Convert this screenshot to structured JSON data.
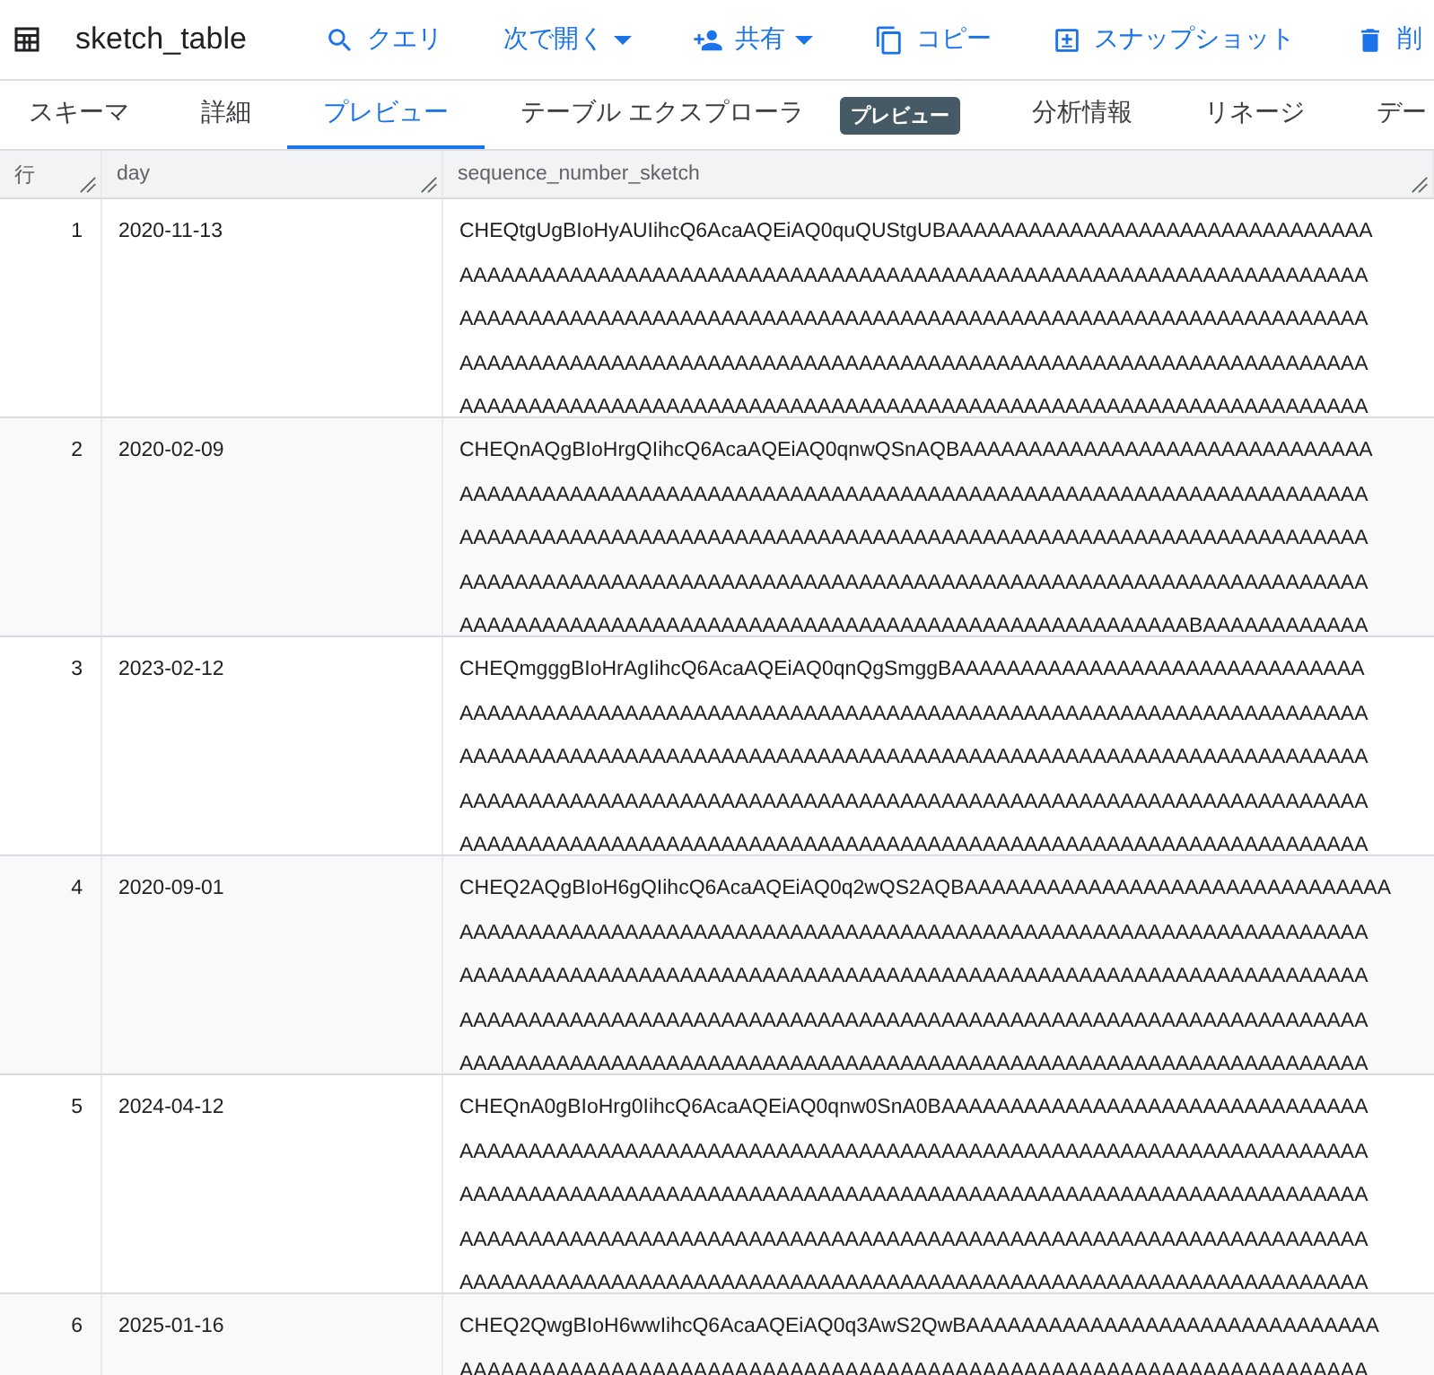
{
  "toolbar": {
    "title": "sketch_table",
    "actions": [
      {
        "kind": "search",
        "label": "クエリ",
        "dropdown": false
      },
      {
        "kind": "none",
        "label": "次で開く",
        "dropdown": true
      },
      {
        "kind": "share",
        "label": "共有",
        "dropdown": true
      },
      {
        "kind": "copy",
        "label": "コピー",
        "dropdown": false
      },
      {
        "kind": "snapshot",
        "label": "スナップショット",
        "dropdown": false
      },
      {
        "kind": "delete",
        "label": "削",
        "dropdown": false
      }
    ]
  },
  "tabs": [
    {
      "label": "スキーマ",
      "selected": false
    },
    {
      "label": "詳細",
      "selected": false
    },
    {
      "label": "プレビュー",
      "selected": true
    },
    {
      "label": "テーブル エクスプローラ",
      "selected": false,
      "badge": "プレビュー"
    },
    {
      "label": "分析情報",
      "selected": false
    },
    {
      "label": "リネージ",
      "selected": false
    },
    {
      "label": "デー",
      "selected": false
    }
  ],
  "table": {
    "columns": [
      "行",
      "day",
      "sequence_number_sketch"
    ],
    "rows": [
      {
        "row": "1",
        "day": "2020-11-13",
        "sketch": [
          "CHEQtgUgBIoHyAUIihcQ6AcaAQEiAQ0quQUStgUBAAAAAAAAAAAAAAAAAAAAAAAAAAAAAAA",
          "AAAAAAAAAAAAAAAAAAAAAAAAAAAAAAAAAAAAAAAAAAAAAAAAAAAAAAAAAAAAAAAAAA",
          "AAAAAAAAAAAAAAAAAAAAAAAAAAAAAAAAAAAAAAAAAAAAAAAAAAAAAAAAAAAAAAAAAA",
          "AAAAAAAAAAAAAAAAAAAAAAAAAAAAAAAAAAAAAAAAAAAAAAAAAAAAAAAAAAAAAAAAAA",
          "AAAAAAAAAAAAAAAAAAAAAAAAAAAAAAAAAAAAAAAAAAAAAAAAAAAAAAAAAAAAAAAAAA"
        ]
      },
      {
        "row": "2",
        "day": "2020-02-09",
        "sketch": [
          "CHEQnAQgBIoHrgQIihcQ6AcaAQEiAQ0qnwQSnAQBAAAAAAAAAAAAAAAAAAAAAAAAAAAAAA",
          "AAAAAAAAAAAAAAAAAAAAAAAAAAAAAAAAAAAAAAAAAAAAAAAAAAAAAAAAAAAAAAAAAA",
          "AAAAAAAAAAAAAAAAAAAAAAAAAAAAAAAAAAAAAAAAAAAAAAAAAAAAAAAAAAAAAAAAAA",
          "AAAAAAAAAAAAAAAAAAAAAAAAAAAAAAAAAAAAAAAAAAAAAAAAAAAAAAAAAAAAAAAAAA",
          "AAAAAAAAAAAAAAAAAAAAAAAAAAAAAAAAAAAAAAAAAAAAAAAAAAAAABAAAAAAAAAAAA"
        ]
      },
      {
        "row": "3",
        "day": "2023-02-12",
        "sketch": [
          "CHEQmgggBIoHrAgIihcQ6AcaAQEiAQ0qnQgSmggBAAAAAAAAAAAAAAAAAAAAAAAAAAAAAA",
          "AAAAAAAAAAAAAAAAAAAAAAAAAAAAAAAAAAAAAAAAAAAAAAAAAAAAAAAAAAAAAAAAAA",
          "AAAAAAAAAAAAAAAAAAAAAAAAAAAAAAAAAAAAAAAAAAAAAAAAAAAAAAAAAAAAAAAAAA",
          "AAAAAAAAAAAAAAAAAAAAAAAAAAAAAAAAAAAAAAAAAAAAAAAAAAAAAAAAAAAAAAAAAA",
          "AAAAAAAAAAAAAAAAAAAAAAAAAAAAAAAAAAAAAAAAAAAAAAAAAAAAAAAAAAAAAAAAAA"
        ]
      },
      {
        "row": "4",
        "day": "2020-09-01",
        "sketch": [
          "CHEQ2AQgBIoH6gQIihcQ6AcaAQEiAQ0q2wQS2AQBAAAAAAAAAAAAAAAAAAAAAAAAAAAAAAA",
          "AAAAAAAAAAAAAAAAAAAAAAAAAAAAAAAAAAAAAAAAAAAAAAAAAAAAAAAAAAAAAAAAAA",
          "AAAAAAAAAAAAAAAAAAAAAAAAAAAAAAAAAAAAAAAAAAAAAAAAAAAAAAAAAAAAAAAAAA",
          "AAAAAAAAAAAAAAAAAAAAAAAAAAAAAAAAAAAAAAAAAAAAAAAAAAAAAAAAAAAAAAAAAA",
          "AAAAAAAAAAAAAAAAAAAAAAAAAAAAAAAAAAAAAAAAAAAAAAAAAAAAAAAAAAAAAAAAAA"
        ]
      },
      {
        "row": "5",
        "day": "2024-04-12",
        "sketch": [
          "CHEQnA0gBIoHrg0IihcQ6AcaAQEiAQ0qnw0SnA0BAAAAAAAAAAAAAAAAAAAAAAAAAAAAAAA",
          "AAAAAAAAAAAAAAAAAAAAAAAAAAAAAAAAAAAAAAAAAAAAAAAAAAAAAAAAAAAAAAAAAA",
          "AAAAAAAAAAAAAAAAAAAAAAAAAAAAAAAAAAAAAAAAAAAAAAAAAAAAAAAAAAAAAAAAAA",
          "AAAAAAAAAAAAAAAAAAAAAAAAAAAAAAAAAAAAAAAAAAAAAAAAAAAAAAAAAAAAAAAAAA",
          "AAAAAAAAAAAAAAAAAAAAAAAAAAAAAAAAAAAAAAAAAAAAAAAAAAAAAAAAAAAAAAAAAA"
        ]
      },
      {
        "row": "6",
        "day": "2025-01-16",
        "sketch": [
          "CHEQ2QwgBIoH6wwIihcQ6AcaAQEiAQ0q3AwS2QwBAAAAAAAAAAAAAAAAAAAAAAAAAAAAAA",
          "AAAAAAAAAAAAAAAAAAAAAAAAAAAAAAAAAAAAAAAAAAAAAAAAAAAAAAAAAAAAAAAAAA"
        ]
      }
    ]
  }
}
